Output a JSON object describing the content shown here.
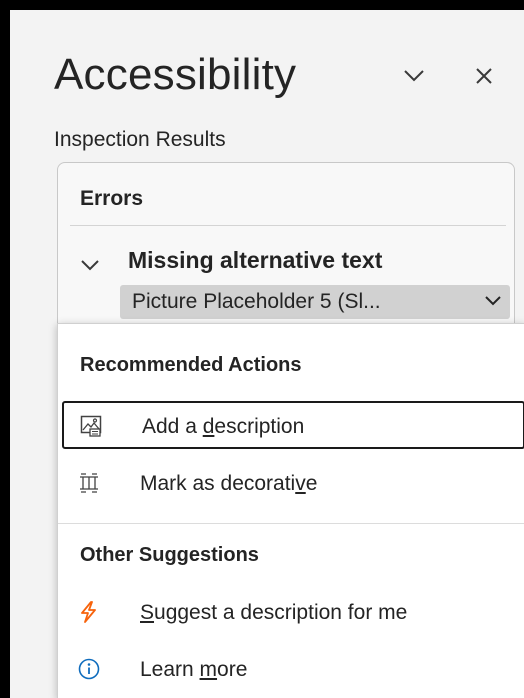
{
  "pane": {
    "title": "Accessibility",
    "collapse_icon": "chevron-down-icon",
    "close_icon": "close-icon"
  },
  "inspection": {
    "subtitle": "Inspection Results",
    "errors_header": "Errors",
    "issue": {
      "title": "Missing alternative text",
      "expand_icon": "chevron-down-icon",
      "object_label": "Picture Placeholder 5  (Sl...",
      "object_menu_icon": "chevron-down-icon"
    }
  },
  "menu": {
    "recommended_header": "Recommended Actions",
    "recommended_items": [
      {
        "pre": "Add a ",
        "key": "d",
        "post": "escription",
        "icon": "image-description-icon"
      },
      {
        "pre": "Mark as decorati",
        "key": "v",
        "post": "e",
        "icon": "decorative-icon"
      }
    ],
    "other_header": "Other Suggestions",
    "other_items": [
      {
        "pre": "",
        "key": "S",
        "post": "uggest a description for me",
        "icon": "lightning-icon",
        "icon_color": "#f7630c"
      },
      {
        "pre": "Learn ",
        "key": "m",
        "post": "ore",
        "icon": "info-icon",
        "icon_color": "#0f6cbd"
      }
    ]
  }
}
